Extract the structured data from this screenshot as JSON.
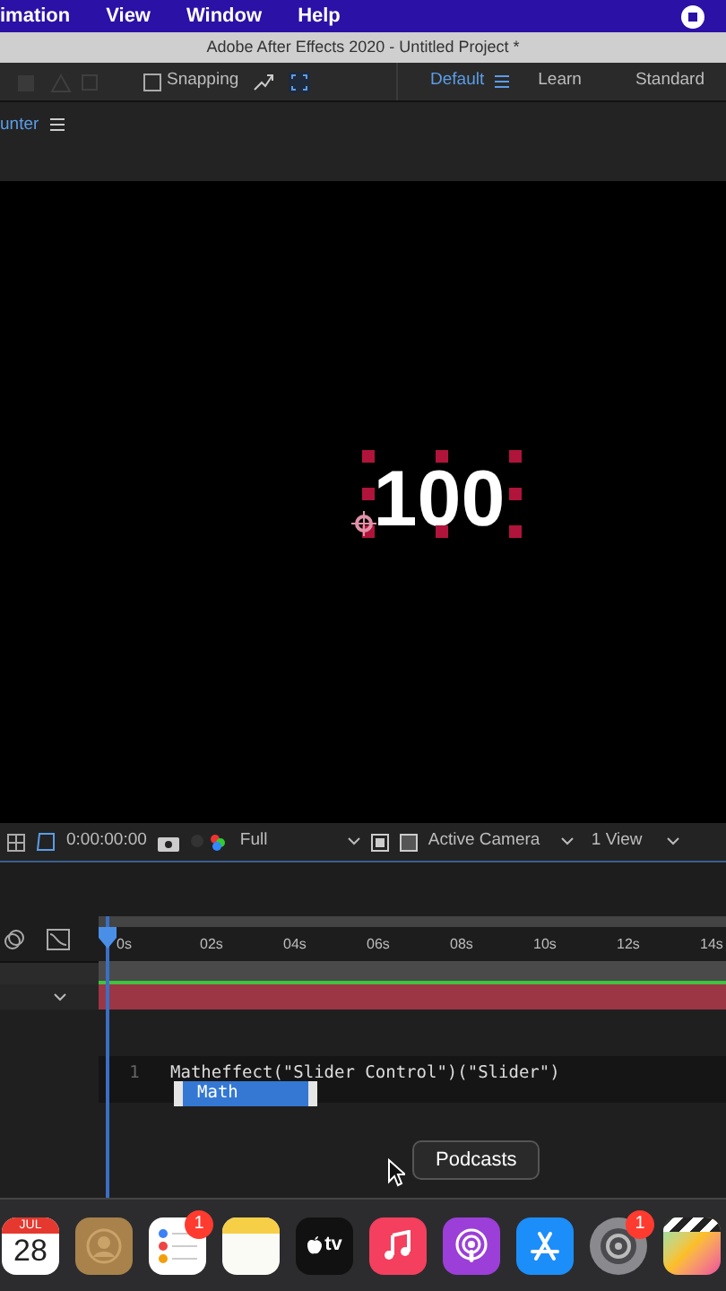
{
  "menu_bar": {
    "items": [
      "imation",
      "View",
      "Window",
      "Help"
    ]
  },
  "window": {
    "title": "Adobe After Effects 2020 - Untitled Project *"
  },
  "toolbar": {
    "snapping": {
      "label": "Snapping",
      "checked": false
    },
    "workspaces": [
      {
        "label": "Default",
        "selected": true
      },
      {
        "label": "Learn",
        "selected": false
      },
      {
        "label": "Standard",
        "selected": false
      }
    ]
  },
  "panel": {
    "title": "unter"
  },
  "viewer": {
    "text": "100"
  },
  "viewer_bar": {
    "timecode": "0:00:00:00",
    "resolution": "Full",
    "camera": "Active Camera",
    "views": "1 View"
  },
  "timeline": {
    "ticks": [
      "0s",
      "02s",
      "04s",
      "06s",
      "08s",
      "10s",
      "12s",
      "14s"
    ]
  },
  "expression": {
    "line_number": "1",
    "code": "Matheffect(\"Slider Control\")(\"Slider\")",
    "suggestion": "Math"
  },
  "tooltip": "Podcasts",
  "dock": {
    "items": [
      {
        "kind": "calendar",
        "month": "JUL",
        "day": "28"
      },
      {
        "kind": "contacts"
      },
      {
        "kind": "reminders",
        "badge": "1"
      },
      {
        "kind": "notes"
      },
      {
        "kind": "tv",
        "label": "tv"
      },
      {
        "kind": "music"
      },
      {
        "kind": "podcasts"
      },
      {
        "kind": "appstore"
      },
      {
        "kind": "settings",
        "badge": "1"
      },
      {
        "kind": "clapper"
      }
    ]
  }
}
